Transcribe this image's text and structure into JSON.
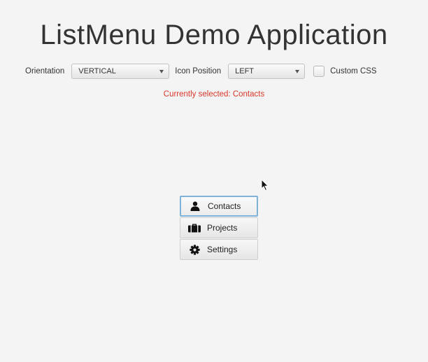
{
  "app": {
    "title": "ListMenu Demo Application"
  },
  "toolbar": {
    "orientation_label": "Orientation",
    "orientation_value": "VERTICAL",
    "icon_position_label": "Icon Position",
    "icon_position_value": "LEFT",
    "custom_css_label": "Custom CSS",
    "custom_css_checked": false
  },
  "status": {
    "text": "Currently selected: Contacts"
  },
  "menu": {
    "items": [
      {
        "label": "Contacts",
        "icon": "person-icon",
        "selected": true
      },
      {
        "label": "Projects",
        "icon": "briefcase-icon",
        "selected": false
      },
      {
        "label": "Settings",
        "icon": "gear-icon",
        "selected": false
      }
    ]
  },
  "colors": {
    "status_text": "#d8372a",
    "selection_border": "#7fb2d8"
  }
}
